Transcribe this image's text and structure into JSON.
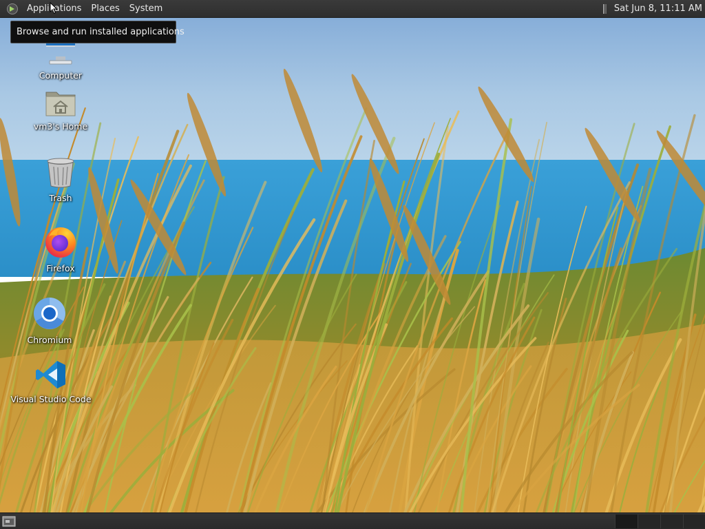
{
  "top_panel": {
    "menus": [
      "Applications",
      "Places",
      "System"
    ],
    "clock": "Sat Jun  8, 11:11 AM"
  },
  "tooltip": {
    "text": "Browse and run installed applications"
  },
  "desktop_icons": [
    {
      "label": "Computer",
      "icon": "monitor-icon"
    },
    {
      "label": "vm3's Home",
      "icon": "home-folder-icon"
    },
    {
      "label": "Trash",
      "icon": "trash-icon"
    },
    {
      "label": "Firefox",
      "icon": "firefox-icon"
    },
    {
      "label": "Chromium",
      "icon": "chromium-icon"
    },
    {
      "label": "Visual Studio Code",
      "icon": "vscode-icon"
    }
  ],
  "bottom_panel": {
    "workspaces": 4,
    "active_workspace": 1
  },
  "colors": {
    "panel_bg": "#333333",
    "tooltip_bg": "#0f0f0f",
    "vscode_blue": "#1f8ad2",
    "chromium_blue": "#4a8ad8"
  }
}
